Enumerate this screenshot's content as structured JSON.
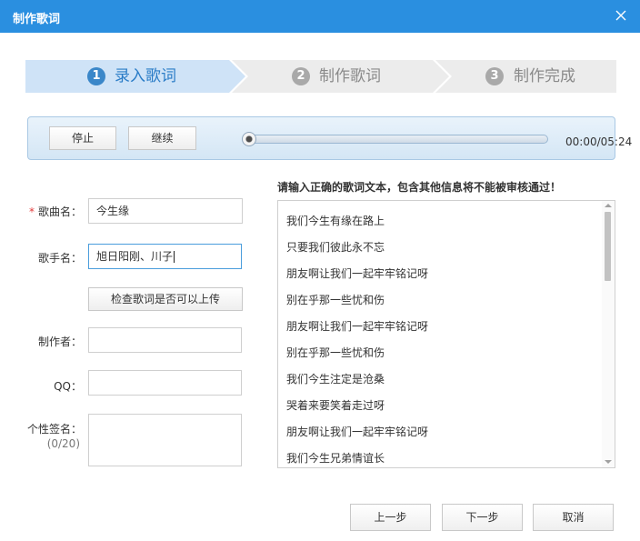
{
  "window": {
    "title": "制作歌词"
  },
  "steps": [
    {
      "number": "1",
      "label": "录入歌词"
    },
    {
      "number": "2",
      "label": "制作歌词"
    },
    {
      "number": "3",
      "label": "制作完成"
    }
  ],
  "player": {
    "stop_label": "停止",
    "continue_label": "继续",
    "time": "00:00/05:24",
    "progress": 0
  },
  "form": {
    "song_name_label": "歌曲名：",
    "song_name_value": "今生缘",
    "singer_label": "歌手名：",
    "singer_value": "旭日阳刚、川子",
    "check_button": "检查歌词是否可以上传",
    "author_label": "制作者：",
    "author_value": "",
    "qq_label": "QQ：",
    "qq_value": "",
    "signature_label": "个性签名：",
    "signature_count": "(0/20)",
    "signature_value": ""
  },
  "lyrics": {
    "hint": "请输入正确的歌词文本，包含其他信息将不能被审核通过！",
    "lines": [
      "我们今生有缘在路上",
      "只要我们彼此永不忘",
      "朋友啊让我们一起牢牢铭记呀",
      "别在乎那一些忧和伤",
      "朋友啊让我们一起牢牢铭记呀",
      "别在乎那一些忧和伤",
      "我们今生注定是沧桑",
      "哭着来要笑着走过呀",
      "朋友啊让我们一起牢牢铭记呀",
      "我们今生兄弟情谊长"
    ]
  },
  "footer": {
    "prev_label": "上一步",
    "next_label": "下一步",
    "cancel_label": "取消"
  },
  "colors": {
    "titlebar": "#2a8fe0",
    "step_active_bg": "#cfe3f7",
    "step_active_text": "#2a7cc7",
    "step_inactive_bg": "#ececec",
    "step_inactive_text": "#8a8a8a"
  }
}
